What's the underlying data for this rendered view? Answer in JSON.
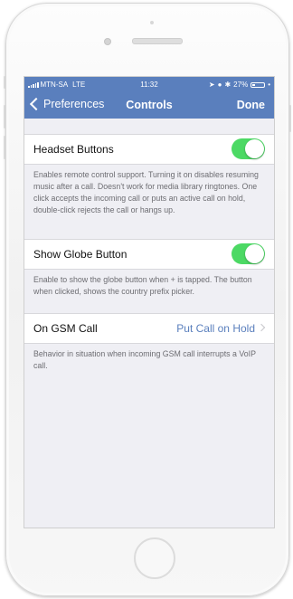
{
  "status_bar": {
    "carrier": "MTN-SA",
    "network": "LTE",
    "time": "11:32",
    "battery": "27%",
    "battery_level": 0.27
  },
  "nav": {
    "back_label": "Preferences",
    "title": "Controls",
    "done_label": "Done"
  },
  "settings": {
    "headset": {
      "label": "Headset Buttons",
      "enabled": true,
      "description": "Enables remote control support. Turning it on disables resuming music after a call. Doesn't work for media library ringtones. One click accepts the incoming call or puts an active call on hold, double-click rejects the call or hangs up."
    },
    "globe": {
      "label": "Show Globe Button",
      "enabled": true,
      "description": "Enable to show the globe button when + is tapped. The button when clicked, shows the country prefix picker."
    },
    "gsm": {
      "label": "On GSM Call",
      "value": "Put Call on Hold",
      "description": "Behavior in situation when incoming GSM call interrupts a VoIP call."
    }
  },
  "colors": {
    "nav_bar": "#5a7fbd",
    "toggle_on": "#4cd964",
    "background": "#efeff4"
  }
}
